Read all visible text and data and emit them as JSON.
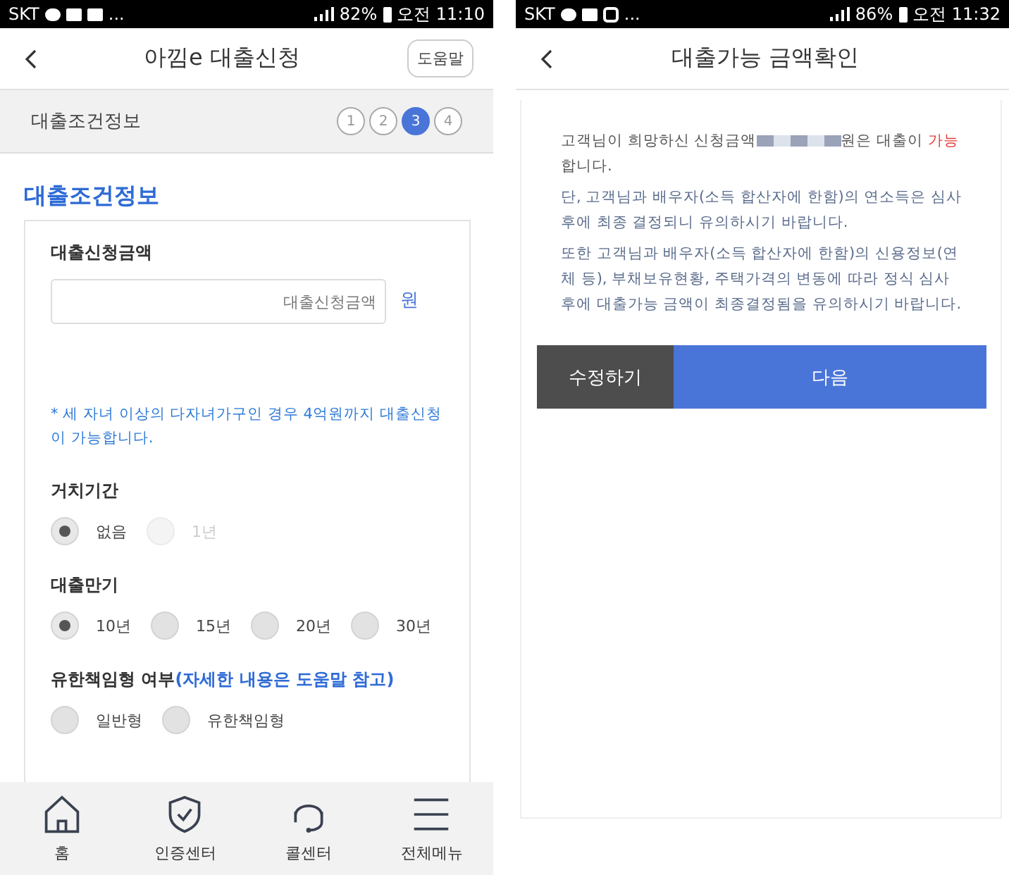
{
  "screens": [
    {
      "status_bar": {
        "carrier": "SKT",
        "more": "...",
        "battery": "82%",
        "time": "오전 11:10"
      },
      "header": {
        "title": "아낌e 대출신청",
        "help_button": "도움말"
      },
      "steps": {
        "label": "대출조건정보",
        "items": [
          {
            "label": "1",
            "selected": false
          },
          {
            "label": "2",
            "selected": false
          },
          {
            "label": "3",
            "selected": true
          },
          {
            "label": "4",
            "selected": false
          }
        ]
      },
      "section_title": "대출조건정보",
      "amount": {
        "label": "대출신청금액",
        "placeholder": "대출신청금액",
        "unit": "원"
      },
      "note": "* 세 자녀 이상의 다자녀가구인 경우 4억원까지 대출신청이 가능합니다.",
      "groups": [
        {
          "label": "거치기간",
          "options": [
            {
              "label": "없음",
              "selected": true,
              "disabled": false
            },
            {
              "label": "1년",
              "selected": false,
              "disabled": true
            }
          ]
        },
        {
          "label": "대출만기",
          "options": [
            {
              "label": "10년",
              "selected": true,
              "disabled": false
            },
            {
              "label": "15년",
              "selected": false,
              "disabled": false
            },
            {
              "label": "20년",
              "selected": false,
              "disabled": false
            },
            {
              "label": "30년",
              "selected": false,
              "disabled": false
            }
          ]
        },
        {
          "label": "유한책임형 여부",
          "hint": "(자세한 내용은 도움말 참고)",
          "options": [
            {
              "label": "일반형",
              "selected": false,
              "disabled": false
            },
            {
              "label": "유한책임형",
              "selected": false,
              "disabled": false
            }
          ]
        }
      ],
      "nav": [
        {
          "kind": "home",
          "label": "홈"
        },
        {
          "kind": "shield",
          "label": "인증센터"
        },
        {
          "kind": "headset",
          "label": "콜센터"
        },
        {
          "kind": "menu",
          "label": "전체메뉴"
        }
      ]
    },
    {
      "status_bar": {
        "carrier": "SKT",
        "more": "...",
        "battery": "86%",
        "time": "오전 11:32"
      },
      "header": {
        "title": "대출가능 금액확인"
      },
      "result": {
        "before": "고객님이 희망하신 신청금액",
        "after": "원은 대출이 ",
        "highlight": "가능",
        "end": "합니다."
      },
      "paragraphs": [
        "단, 고객님과 배우자(소득 합산자에 한함)의 연소득은 심사 후에 최종 결정되니 유의하시기 바랍니다.",
        "또한 고객님과 배우자(소득 합산자에 한함)의 신용정보(연체 등), 부채보유현황, 주택가격의 변동에 따라 정식 심사 후에 대출가능 금액이 최종결정됨을 유의하시기 바랍니다."
      ],
      "buttons": [
        {
          "kind": "secondary",
          "label": "수정하기"
        },
        {
          "kind": "primary",
          "label": "다음"
        }
      ]
    }
  ]
}
